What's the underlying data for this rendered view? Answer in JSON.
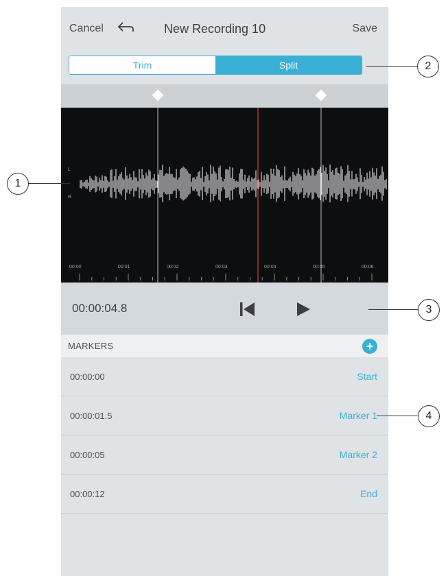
{
  "header": {
    "cancel_label": "Cancel",
    "title": "New Recording 10",
    "save_label": "Save",
    "undo_icon": "undo-arrow-icon"
  },
  "mode_toggle": {
    "options": [
      "Trim",
      "Split"
    ],
    "selected": "Split"
  },
  "waveform": {
    "channel_labels": [
      "L",
      "R"
    ],
    "time_ticks": [
      "00:00",
      "00:01",
      "00:02",
      "00:03",
      "00:04",
      "00:05",
      "00:06"
    ],
    "playhead_time_s": 3.9,
    "split_handles_time_s": [
      1.8,
      4.9
    ]
  },
  "transport": {
    "current_time": "00:00:04.8",
    "skip_back_icon": "skip-to-start-icon",
    "play_icon": "play-icon"
  },
  "markers": {
    "title": "MARKERS",
    "add_icon": "plus-icon",
    "items": [
      {
        "time": "00:00:00",
        "label": "Start"
      },
      {
        "time": "00:00:01.5",
        "label": "Marker 1"
      },
      {
        "time": "00:00:05",
        "label": "Marker 2"
      },
      {
        "time": "00:00:12",
        "label": "End"
      }
    ]
  },
  "callouts": [
    "1",
    "2",
    "3",
    "4"
  ],
  "colors": {
    "accent": "#3bb0d6",
    "playhead": "#e0392b",
    "waveform_bg": "#0d0e10",
    "waveform": "#ffffff"
  }
}
